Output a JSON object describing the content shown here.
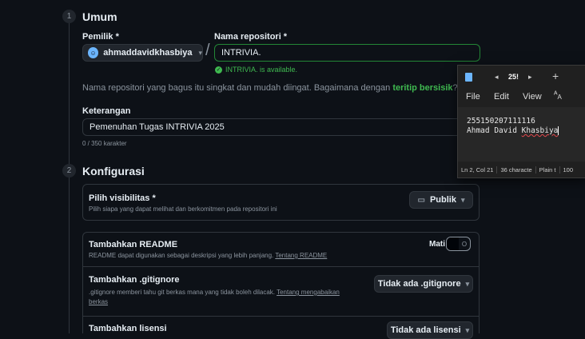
{
  "section1": {
    "step": "1",
    "title": "Umum",
    "owner_label": "Pemilik *",
    "owner_value": "ahmaddavidkhasbiya",
    "repo_label": "Nama repositori *",
    "repo_value": "INTRIVIA.",
    "availability": "INTRIVIA. is available.",
    "hint_text": "Nama repositori yang bagus itu singkat dan mudah diingat. Bagaimana dengan ",
    "hint_link": "teritip bersisik",
    "hint_end": "?",
    "desc_label": "Keterangan",
    "desc_value": "Pemenuhan Tugas INTRIVIA 2025",
    "desc_count": "0 / 350 karakter"
  },
  "section2": {
    "step": "2",
    "title": "Konfigurasi",
    "visibility": {
      "title": "Pilih visibilitas *",
      "desc": "Pilih siapa yang dapat melihat dan berkomitmen pada repositori ini",
      "button": "Publik"
    },
    "readme": {
      "title": "Tambahkan README",
      "desc": "README dapat digunakan sebagai deskripsi yang lebih panjang. ",
      "link": "Tentang README",
      "state_label": "Mati",
      "toggle_glyph": "O"
    },
    "gitignore": {
      "title": "Tambahkan .gitignore",
      "desc": ".gitignore memberi tahu git berkas mana yang tidak boleh dilacak. ",
      "link1": "Tentang mengabaikan",
      "link2": "berkas",
      "button": "Tidak ada .gitignore"
    },
    "license": {
      "title": "Tambahkan lisensi",
      "button": "Tidak ada lisensi"
    }
  },
  "notepad": {
    "tab_label": "25!",
    "menu": [
      "File",
      "Edit",
      "View"
    ],
    "line1": "255150207111116",
    "line2_prefix": "Ahmad David ",
    "line2_misspelled": "Khasbiya",
    "status": [
      "Ln 2, Col 21",
      "36 characte",
      "Plain t",
      "100"
    ]
  },
  "colors": {
    "accent_green": "#3fb950",
    "input_border_success": "#238636",
    "background": "#0d1117"
  }
}
